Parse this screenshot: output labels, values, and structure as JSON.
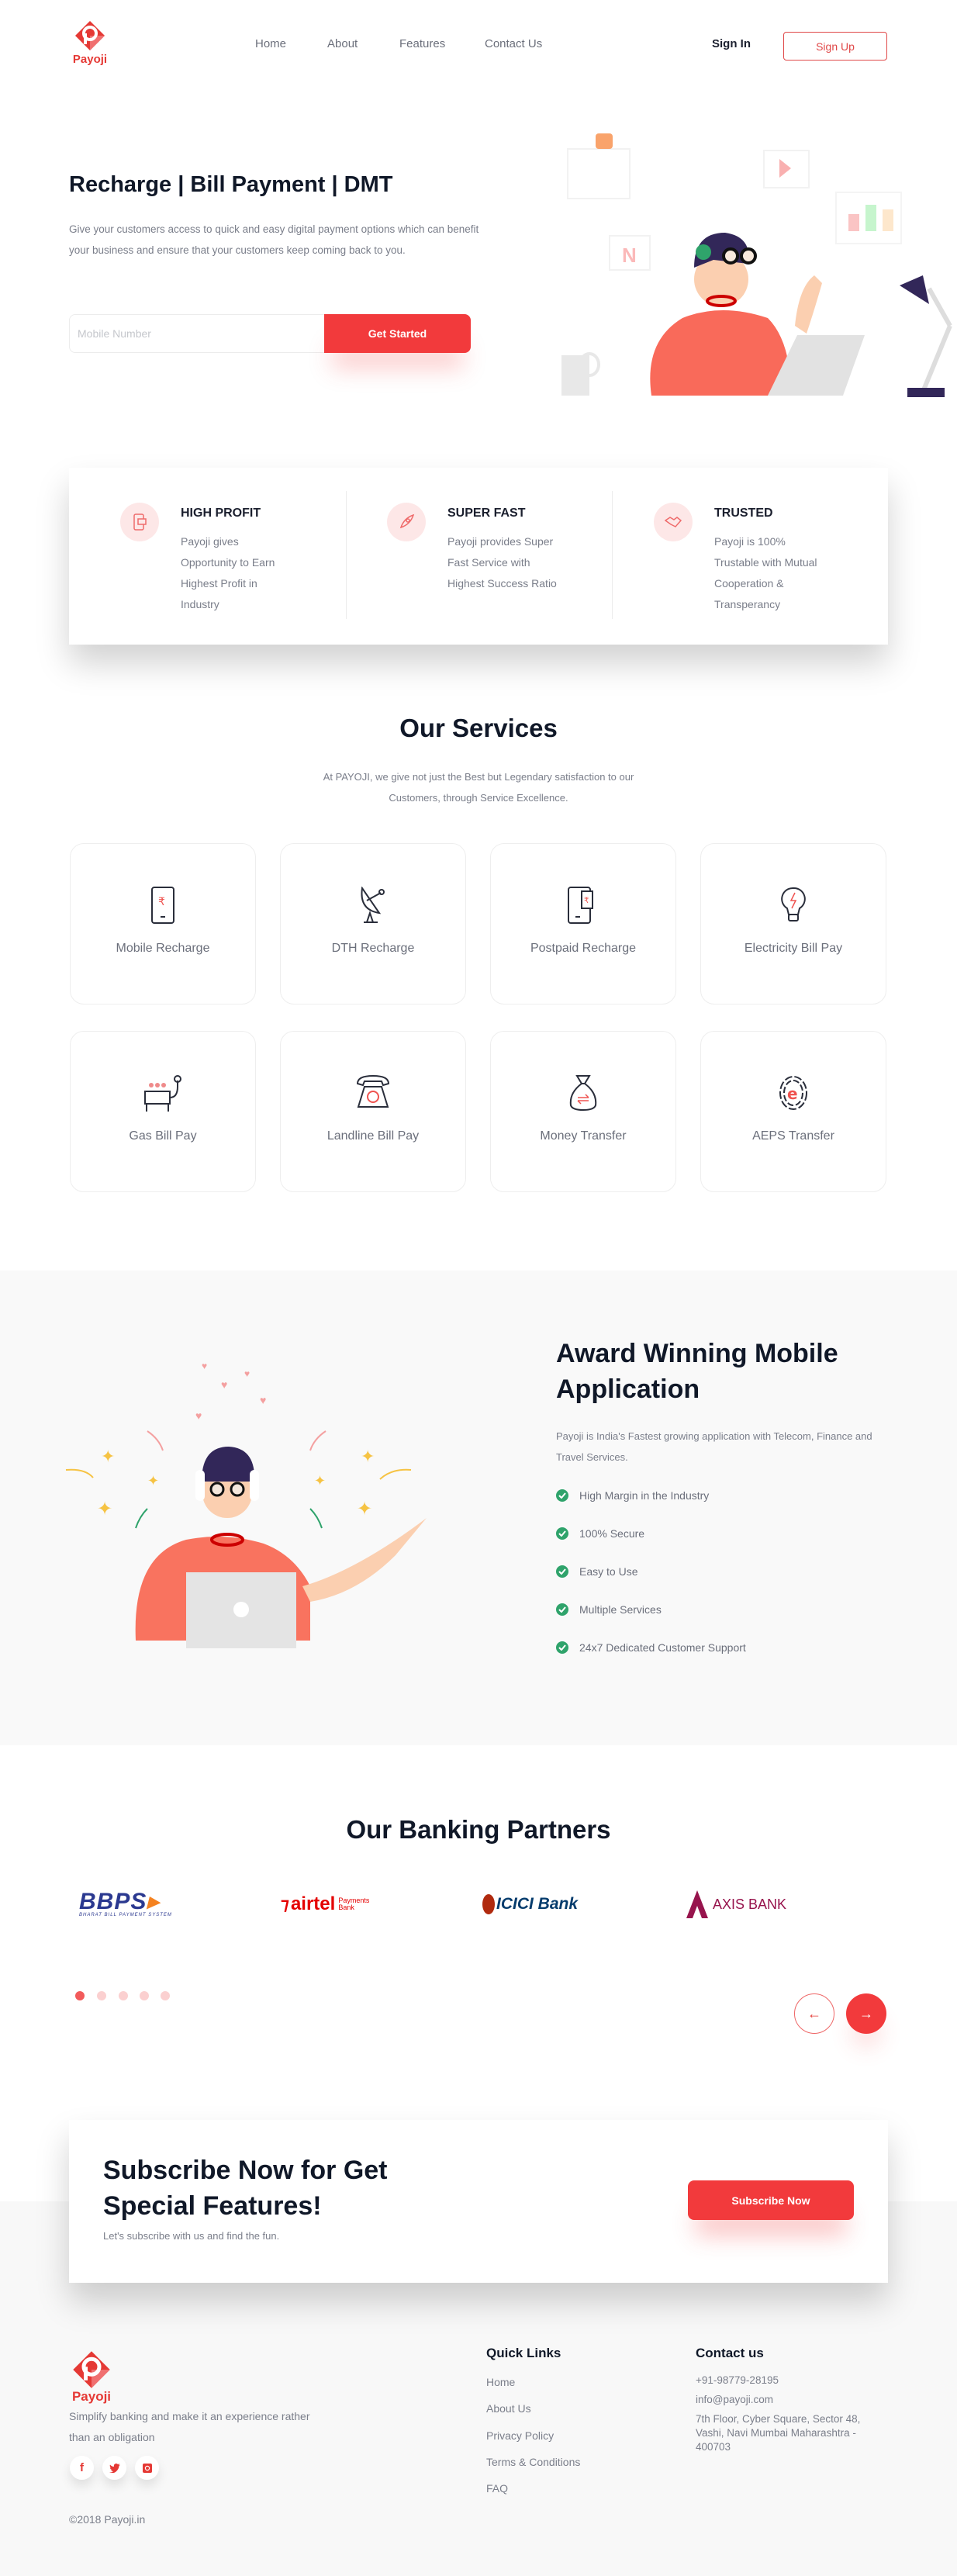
{
  "brand": {
    "name": "Payoji",
    "accent": "#f23a3c"
  },
  "nav": {
    "items": [
      "Home",
      "About",
      "Features",
      "Contact Us"
    ],
    "sign_in": "Sign In",
    "sign_up": "Sign Up"
  },
  "hero": {
    "title": "Recharge | Bill Payment | DMT",
    "description": "Give your customers access to quick and easy digital payment options which can benefit your business and ensure that your customers keep coming back to you.",
    "input_placeholder": "Mobile Number",
    "input_value": "",
    "cta": "Get Started"
  },
  "features": [
    {
      "icon": "phone-cash-icon",
      "title": "HIGH PROFIT",
      "description": "Payoji gives Opportunity to Earn Highest Profit in Industry"
    },
    {
      "icon": "rocket-icon",
      "title": "SUPER FAST",
      "description": "Payoji provides Super Fast Service with Highest Success Ratio"
    },
    {
      "icon": "handshake-icon",
      "title": "TRUSTED",
      "description": "Payoji is 100% Trustable with Mutual Cooperation & Transperancy"
    }
  ],
  "services": {
    "title": "Our Services",
    "subtitle": "At PAYOJI, we give not just the Best but Legendary satisfaction to our Customers, through Service Excellence.",
    "items": [
      {
        "icon": "mobile-rupee-icon",
        "label": "Mobile Recharge"
      },
      {
        "icon": "satellite-dish-icon",
        "label": "DTH Recharge"
      },
      {
        "icon": "mobile-bill-icon",
        "label": "Postpaid Recharge"
      },
      {
        "icon": "light-bulb-icon",
        "label": "Electricity Bill Pay"
      },
      {
        "icon": "gas-stove-icon",
        "label": "Gas Bill Pay"
      },
      {
        "icon": "telephone-icon",
        "label": "Landline Bill Pay"
      },
      {
        "icon": "money-bag-icon",
        "label": "Money Transfer"
      },
      {
        "icon": "fingerprint-e-icon",
        "label": "AEPS Transfer"
      }
    ]
  },
  "award": {
    "title": "Award Winning Mobile Application",
    "description": "Payoji is India's Fastest growing application with Telecom, Finance and Travel Services.",
    "points": [
      "High Margin in the Industry",
      "100% Secure",
      "Easy to Use",
      "Multiple Services",
      "24x7 Dedicated Customer Support"
    ],
    "check_color": "#2fa36b"
  },
  "partners": {
    "title": "Our Banking Partners",
    "logos": [
      {
        "name": "BBPS",
        "tagline": "BHARAT BILL PAYMENT SYSTEM"
      },
      {
        "name": "airtel",
        "tagline": "Payments Bank"
      },
      {
        "name": "ICICI Bank",
        "tagline": ""
      },
      {
        "name": "AXIS BANK",
        "tagline": ""
      }
    ],
    "pages": 5,
    "active_page": 1
  },
  "subscribe": {
    "title": "Subscribe Now for Get Special Features!",
    "description": "Let's subscribe with us and find the fun.",
    "button": "Subscribe Now"
  },
  "footer": {
    "tagline": "Simplify banking and make it an experience rather than an obligation",
    "social": [
      "facebook",
      "twitter",
      "instagram"
    ],
    "copyright": "©2018 Payoji.in",
    "quick_links_title": "Quick Links",
    "quick_links": [
      "Home",
      "About Us",
      "Privacy Policy",
      "Terms & Conditions",
      "FAQ"
    ],
    "contact_title": "Contact us",
    "phone": "+91-98779-28195",
    "email": "info@payoji.com",
    "address": "7th Floor, Cyber Square, Sector 48, Vashi, Navi Mumbai Maharashtra - 400703"
  }
}
